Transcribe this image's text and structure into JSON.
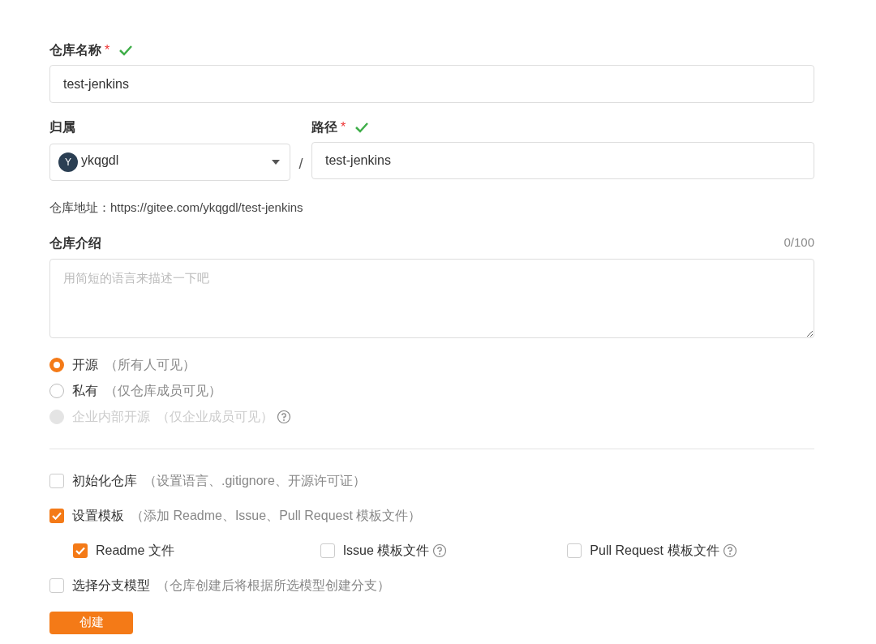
{
  "name_field": {
    "label": "仓库名称",
    "required": "*",
    "valid": true,
    "value": "test-jenkins"
  },
  "owner": {
    "label": "归属",
    "avatar": "Y",
    "value": "ykqgdl"
  },
  "separator": "/",
  "path_field": {
    "label": "路径",
    "required": "*",
    "valid": true,
    "value": "test-jenkins"
  },
  "address": "仓库地址：https://gitee.com/ykqgdl/test-jenkins",
  "description": {
    "label": "仓库介绍",
    "counter": "0/100",
    "placeholder": "用简短的语言来描述一下吧"
  },
  "visibility": [
    {
      "label": "开源",
      "hint": "（所有人可见）",
      "selected": true,
      "disabled": false,
      "help": false
    },
    {
      "label": "私有",
      "hint": "（仅仓库成员可见）",
      "selected": false,
      "disabled": false,
      "help": false
    },
    {
      "label": "企业内部开源",
      "hint": "（仅企业成员可见）",
      "selected": false,
      "disabled": true,
      "help": true
    }
  ],
  "options": [
    {
      "label": "初始化仓库",
      "hint": "（设置语言、.gitignore、开源许可证）",
      "checked": false
    },
    {
      "label": "设置模板",
      "hint": "（添加 Readme、Issue、Pull Request 模板文件）",
      "checked": true,
      "children": [
        {
          "label": "Readme 文件",
          "checked": true,
          "help": false
        },
        {
          "label": "Issue 模板文件",
          "checked": false,
          "help": true
        },
        {
          "label": "Pull Request 模板文件",
          "checked": false,
          "help": true
        }
      ]
    },
    {
      "label": "选择分支模型",
      "hint": "（仓库创建后将根据所选模型创建分支）",
      "checked": false
    }
  ],
  "submit": "创建"
}
